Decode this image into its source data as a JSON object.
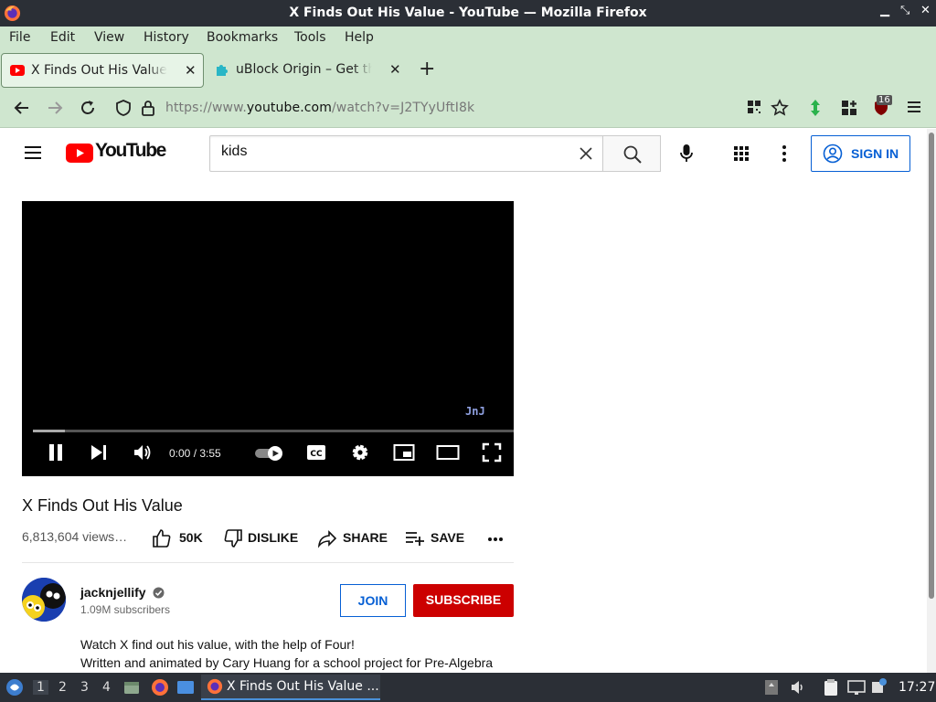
{
  "window": {
    "title": "X Finds Out His Value - YouTube — Mozilla Firefox"
  },
  "menu": {
    "file": "File",
    "edit": "Edit",
    "view": "View",
    "history": "History",
    "bookmarks": "Bookmarks",
    "tools": "Tools",
    "help": "Help"
  },
  "tabs": [
    {
      "label": "X Finds Out His Value - YouTube"
    },
    {
      "label": "uBlock Origin – Get this Extension"
    }
  ],
  "address": {
    "prefix": "https://www.",
    "domain": "youtube.com",
    "path": "/watch?v=J2TYyUftI8k"
  },
  "extension_badge": "16",
  "youtube": {
    "logo_text": "YouTube",
    "search_value": "kids",
    "signin_label": "SIGN IN"
  },
  "player": {
    "time": "0:00 / 3:55",
    "watermark": "JnJ",
    "loaded_fraction": 0.067
  },
  "video": {
    "title": "X Finds Out His Value",
    "views": "6,813,604 views…",
    "likes": "50K",
    "dislike_label": "DISLIKE",
    "share_label": "SHARE",
    "save_label": "SAVE"
  },
  "channel": {
    "name": "jacknjellify",
    "subscribers": "1.09M subscribers",
    "join_label": "JOIN",
    "subscribe_label": "SUBSCRIBE"
  },
  "description": {
    "line1": "Watch X find out his value, with the help of Four!",
    "line2": "Written and animated by Cary Huang for a school project for Pre-Algebra"
  },
  "taskbar": {
    "workspaces": [
      "1",
      "2",
      "3",
      "4"
    ],
    "window_label": "X Finds Out His Value ...",
    "clock": "17:27"
  },
  "colors": {
    "accent_blue": "#065fd4",
    "subscribe_red": "#cc0000",
    "browser_green": "#cfe6cf"
  }
}
